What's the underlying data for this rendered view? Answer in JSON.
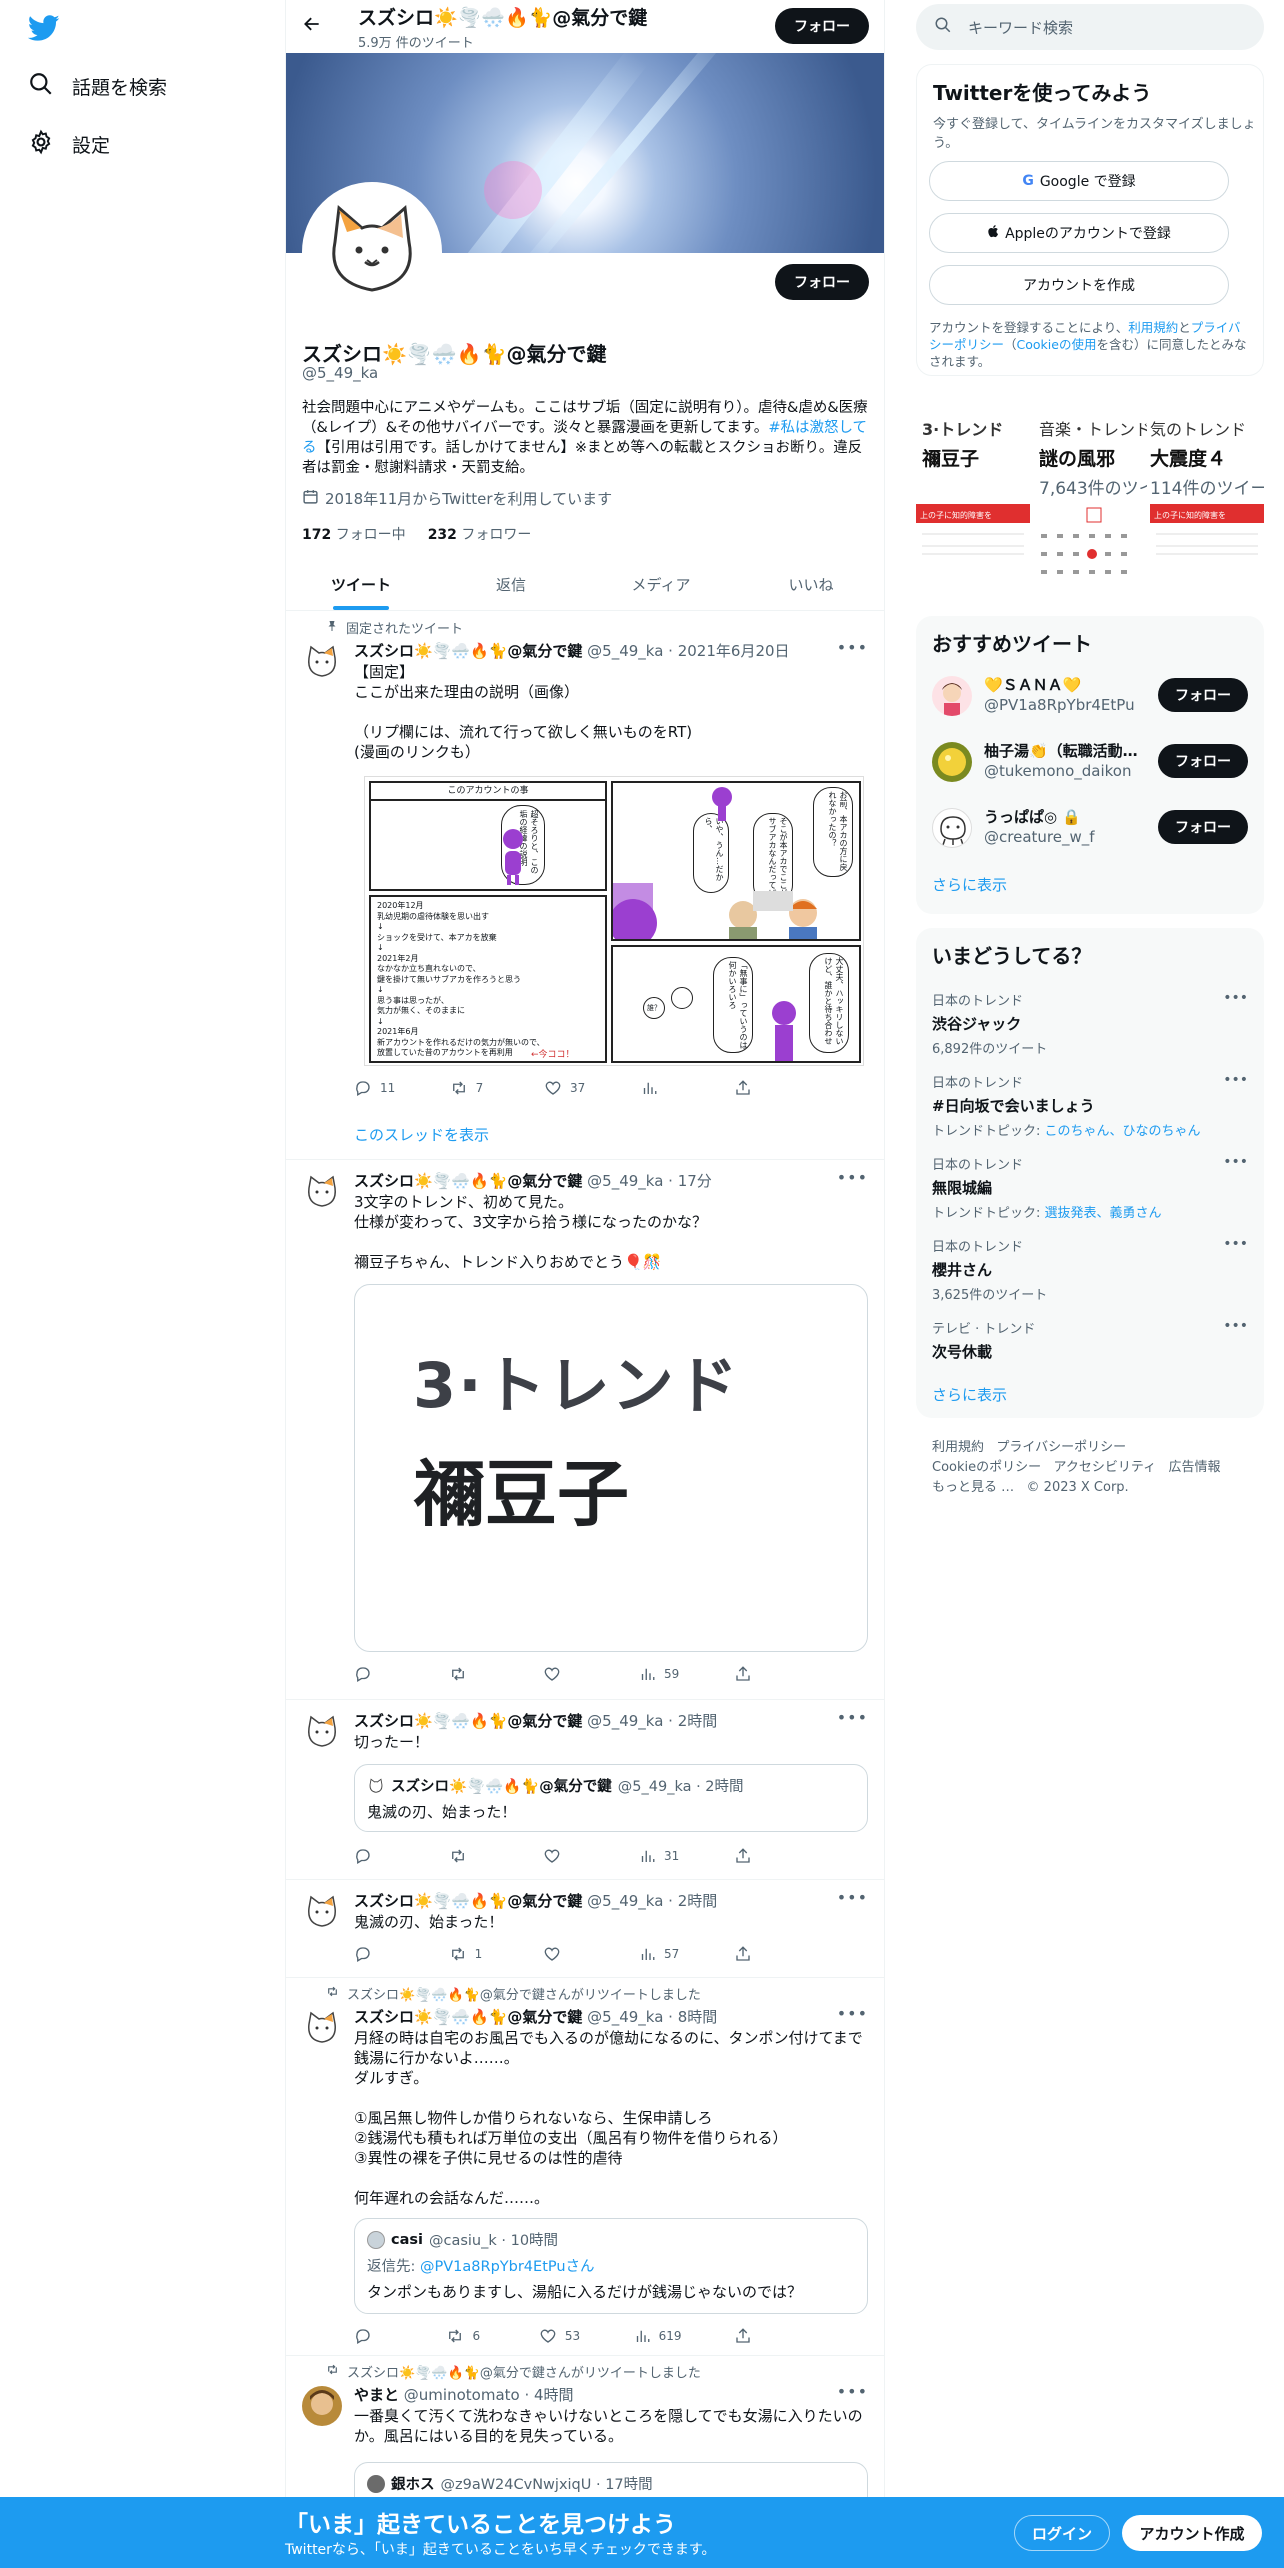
{
  "nav": {
    "explore_label": "話題を検索",
    "settings_label": "設定"
  },
  "header": {
    "name": "スズシロ☀️🌪️🌨️🔥🐈@氣分で鍵",
    "tweet_count": "5.9万 件のツイート",
    "follow_label": "フォロー"
  },
  "profile": {
    "follow_label": "フォロー",
    "display_name": "スズシロ☀️🌪️🌨️🔥🐈@氣分で鍵",
    "handle": "@5_49_ka",
    "bio_part1": "社会問題中心にアニメやゲームも。ここはサブ垢（固定に説明有り）。虐待&虐め&医療（&レイプ）&その他サバイバーです。淡々と暴露漫画を更新してます。",
    "bio_link": "#私は激怒してる",
    "bio_part2": "【引用は引用です。話しかけてません】※まとめ等への転載とスクショお断り。違反者は罰金・慰謝料請求・天罰支給。",
    "joined": "2018年11月からTwitterを利用しています",
    "following_count": "172",
    "following_label": "フォロー中",
    "followers_count": "232",
    "followers_label": "フォロワー"
  },
  "tabs": [
    "ツイート",
    "返信",
    "メディア",
    "いいね"
  ],
  "tweets": [
    {
      "context": "固定されたツイート",
      "name": "スズシロ☀️🌪️🌨️🔥🐈@氣分で鍵",
      "meta": "@5_49_ka · 2021年6月20日",
      "text": "【固定】\nここが出来た理由の説明（画像）\n\n（リプ欄には、流れて行って欲しく無いものをRT)\n(漫画のリンクも）",
      "replies": "11",
      "retweets": "7",
      "likes": "37",
      "views": "",
      "thread_link": "このスレッドを表示",
      "manga": {
        "panel1_title": "このアカウントの事",
        "panel1_bubble": "超そろりと、この垢の経緯の説明",
        "panel2_text": "2020年12月\n乳幼児期の虐待体験を思い出す\n↓\nショックを受けて、本アカを放棄\n↓\n2021年2月\nなかなか立ち直れないので、\n鍵を掛けて無いサブアカを作ろうと思う\n↓\n思う事は思ったが、\n気力が無く、そのままに\n↓\n2021年6月\n新アカウントを作れるだけの気力が無いので、\n放置していた昔のアカウントを再利用",
        "panel2_note": "←今ココ！",
        "bubble_a": "いや、うん…だから、",
        "bubble_b": "そこが本アカでここがサブアカなんだってば",
        "bubble_c": "お前、本アカの方に戻れなかったの？",
        "bubble_d": "大丈夫、ハッキリしないけど、誰かと待ち合わせ",
        "bubble_e": "「無事に」っていうのは何かいろいろ",
        "bubble_f": "誰？"
      }
    },
    {
      "name": "スズシロ☀️🌪️🌨️🔥🐈@氣分で鍵",
      "meta": "@5_49_ka · 17分",
      "text": "3文字のトレンド、初めて見た。\n仕様が変わって、3文字から拾う様になったのかな？\n\n禰豆子ちゃん、トレンド入りおめでとう🎈🎊",
      "image_line1": "3·トレンド",
      "image_line2": "禰豆子",
      "replies": "",
      "retweets": "",
      "likes": "",
      "views": "59"
    },
    {
      "name": "スズシロ☀️🌪️🌨️🔥🐈@氣分で鍵",
      "meta": "@5_49_ka · 2時間",
      "text": "切ったー！",
      "quote_name": "スズシロ☀️🌪️🌨️🔥🐈@氣分で鍵",
      "quote_meta": "@5_49_ka · 2時間",
      "quote_text": "鬼滅の刃、始まった！",
      "replies": "",
      "retweets": "",
      "likes": "",
      "views": "31"
    },
    {
      "name": "スズシロ☀️🌪️🌨️🔥🐈@氣分で鍵",
      "meta": "@5_49_ka · 2時間",
      "text": "鬼滅の刃、始まった！",
      "replies": "",
      "retweets": "1",
      "likes": "",
      "views": "57"
    },
    {
      "context": "スズシロ☀️🌪️🌨️🔥🐈@氣分で鍵さんがリツイートしました",
      "name": "スズシロ☀️🌪️🌨️🔥🐈@氣分で鍵",
      "meta": "@5_49_ka · 8時間",
      "text": "月経の時は自宅のお風呂でも入るのが億劫になるのに、タンポン付けてまで銭湯に行かないよ……。\nダルすぎ。\n\n①風呂無し物件しか借りられないなら、生保申請しろ\n②銭湯代も積もれば万単位の支出（風呂有り物件を借りられる）\n③異性の裸を子供に見せるのは性的虐待\n\n何年遅れの会話なんだ……。",
      "quote_name": "casi",
      "quote_meta": "@casiu_k · 10時間",
      "quote_reply_prefix": "返信先:",
      "quote_reply_to": "@PV1a8RpYbr4EtPuさん",
      "quote_text": "タンポンもありますし、湯船に入るだけが銭湯じゃないのでは？",
      "replies": "",
      "retweets": "6",
      "likes": "53",
      "views": "619"
    },
    {
      "context": "スズシロ☀️🌪️🌨️🔥🐈@氣分で鍵さんがリツイートしました",
      "name": "やまと",
      "meta": "@uminotomato · 4時間",
      "text": "一番臭くて汚くて洗わなきゃいけないところを隠してでも女湯に入りたいのか。風呂にはいる目的を見失っている。",
      "quote_name": "銀ホス",
      "quote_meta": "@z9aW24CvNwjxiqU · 17時間"
    }
  ],
  "right": {
    "search_placeholder": "キーワード検索",
    "signup": {
      "title": "Twitterを使ってみよう",
      "subtitle": "今すぐ登録して、タイムラインをカスタマイズしましょう。",
      "google": "Google で登録",
      "apple": "Appleのアカウントで登録",
      "create": "アカウントを作成",
      "legal_1": "アカウントを登録することにより、",
      "legal_terms": "利用規約",
      "legal_2": "と",
      "legal_privacy": "プライバシーポリシー",
      "legal_3": "（",
      "legal_cookie": "Cookieの使用",
      "legal_4": "を含む）に同意したとみなされます。"
    },
    "trend_tiles": [
      {
        "line1": "3·トレンド",
        "line2": "禰豆子",
        "line3": ""
      },
      {
        "line1": "音楽・トレンド",
        "line2": "謎の風邪",
        "line3": "7,643件のツイ"
      },
      {
        "line1": "気のトレンド",
        "line2": "大震度４",
        "line3": "114件のツイー"
      }
    ],
    "tile_cal_title": "上の子に知的障害を",
    "recommended": {
      "title": "おすすめツイート",
      "users": [
        {
          "name": "💛ＳＡＮＡ💛",
          "handle": "@PV1a8RpYbr4EtPu",
          "follow": "フォロー"
        },
        {
          "name": "柚子湯👏（転職活動…",
          "handle": "@tukemono_daikon",
          "follow": "フォロー"
        },
        {
          "name": "うっぱぱ◎ 🔒",
          "handle": "@creature_w_f",
          "follow": "フォロー"
        }
      ],
      "more": "さらに表示"
    },
    "trends": {
      "title": "いまどうしてる？",
      "items": [
        {
          "meta": "日本のトレンド",
          "name": "渋谷ジャック",
          "sub": "6,892件のツイート",
          "topic_label": "",
          "topic": ""
        },
        {
          "meta": "日本のトレンド",
          "name": "#日向坂で会いましょう",
          "sub": "",
          "topic_label": "トレンドトピック: ",
          "topic": "このちゃん、ひなのちゃん"
        },
        {
          "meta": "日本のトレンド",
          "name": "無限城編",
          "sub": "",
          "topic_label": "トレンドトピック: ",
          "topic": "選抜発表、義勇さん"
        },
        {
          "meta": "日本のトレンド",
          "name": "櫻井さん",
          "sub": "3,625件のツイート",
          "topic_label": "",
          "topic": ""
        },
        {
          "meta": "テレビ · トレンド",
          "name": "次号休載",
          "sub": "",
          "topic_label": "",
          "topic": ""
        }
      ],
      "more": "さらに表示"
    },
    "footer": {
      "terms": "利用規約",
      "privacy": "プライバシーポリシー",
      "cookie": "Cookieのポリシー",
      "accessibility": "アクセシビリティ",
      "ads": "広告情報",
      "more": "もっと見る …",
      "copyright": "© 2023 X Corp."
    }
  },
  "bottom_bar": {
    "title": "「いま」起きていることを見つけよう",
    "subtitle": "Twitterなら、「いま」起きていることをいち早くチェックできます。",
    "login": "ログイン",
    "signup": "アカウント作成"
  },
  "colors": {
    "accent": "#1d9bf0",
    "text": "#0f1419",
    "muted": "#536471",
    "border": "#eff3f4"
  }
}
